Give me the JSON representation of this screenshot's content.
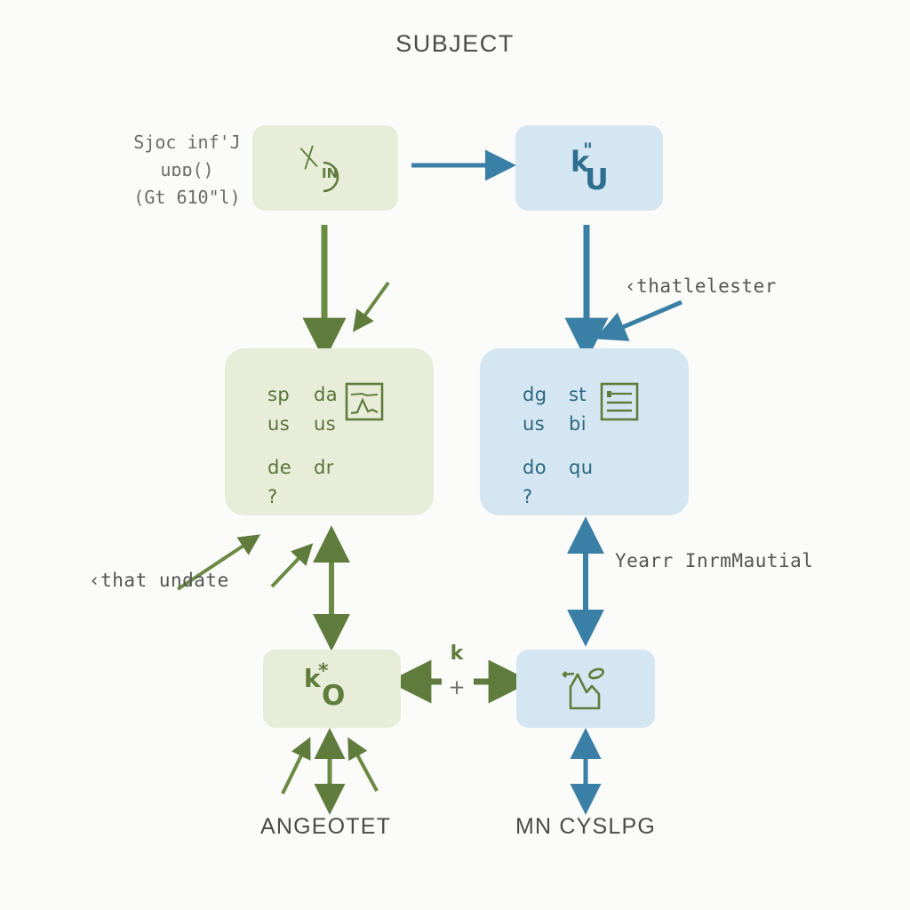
{
  "title": "SUBJECT",
  "colors": {
    "green_fill": "#e7edd9",
    "blue_fill": "#d4e6f1",
    "green_stroke": "#5f7c3c",
    "blue_stroke": "#3a7fa5",
    "text_dark": "#4b4b4b",
    "background": "#fbfbfa"
  },
  "corner_label": {
    "line1": "Sjoc inf'J",
    "line2": "uɒɒ()",
    "line3": "(Gt 610\"l)"
  },
  "boxes": {
    "top_green": {
      "glyph_primary": "ᚷ",
      "glyph_secondary": "IN",
      "icon": "partial-circle-in-icon"
    },
    "top_blue": {
      "glyph_primary": "k",
      "glyph_mark": "\"",
      "glyph_secondary": "U"
    },
    "mid_green": {
      "rows": [
        [
          "sp",
          "da"
        ],
        [
          "us",
          "us"
        ],
        [
          "de",
          "dr"
        ],
        [
          "?",
          ""
        ]
      ],
      "icon": "chart-graph-icon"
    },
    "mid_blue": {
      "rows": [
        [
          "dg",
          "st"
        ],
        [
          "us",
          "bi"
        ],
        [
          "do",
          "qu"
        ],
        [
          "?",
          ""
        ]
      ],
      "icon": "document-list-icon"
    },
    "bottom_green": {
      "glyph_primary": "k",
      "glyph_mark": "*",
      "glyph_secondary": "O"
    },
    "bottom_blue": {
      "icon": "mountain-image-icon"
    }
  },
  "annotations": {
    "right_upper": "‹thatlelester",
    "left_middle": "‹that undate",
    "right_middle": "Yearr InrmMautial",
    "center_symbol": "k",
    "center_plus": "+"
  },
  "bottom_labels": {
    "left": "ANGEOTET",
    "right": "MN CYSLPG"
  }
}
